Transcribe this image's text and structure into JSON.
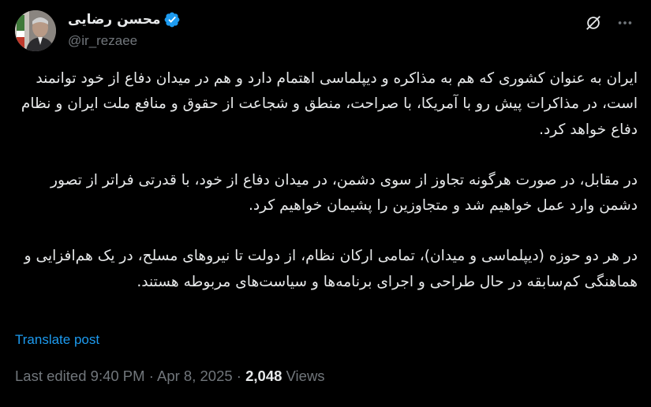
{
  "author": {
    "display_name": "محسن رضایی",
    "handle": "@ir_rezaee",
    "verified": true
  },
  "icons": {
    "verified": "verified-badge-icon",
    "grok": "grok-icon",
    "more": "more-options-icon"
  },
  "post": {
    "paragraphs": [
      "ایران به عنوان کشوری که هم به مذاکره و دیپلماسی اهتمام دارد و هم در میدان دفاع از خود توانمند است، در مذاکرات پیش رو با آمریکا، با صراحت، منطق و شجاعت از حقوق و منافع ملت ایران و نظام دفاع خواهد کرد.",
      "در مقابل، در صورت هرگونه تجاوز از سوی دشمن، در میدان دفاع از خود، با قدرتی فراتر از تصور دشمن وارد عمل خواهیم شد و متجاوزین را پشیمان خواهیم کرد.",
      "در هر دو حوزه (دیپلماسی و میدان)، تمامی ارکان نظام، از دولت تا نیروهای مسلح، در یک هم‌افزایی و هماهنگی کم‌سابقه در حال طراحی و اجرای برنامه‌ها و سیاست‌های مربوطه هستند."
    ],
    "translate_label": "Translate post"
  },
  "meta": {
    "edited_label": "Last edited 9:40 PM",
    "separator": "·",
    "date": "Apr 8, 2025",
    "views_count": "2,048",
    "views_label": "Views"
  },
  "colors": {
    "background": "#000000",
    "text": "#e7e9ea",
    "muted": "#71767b",
    "accent": "#1d9bf0"
  }
}
